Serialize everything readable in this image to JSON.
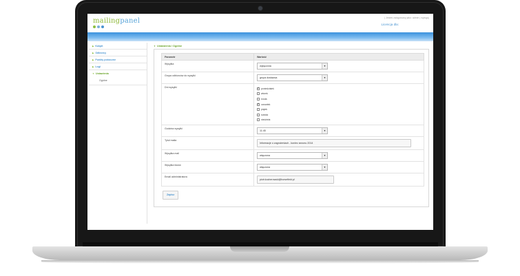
{
  "app": {
    "logo_part1": "mailing",
    "logo_part2": "panel",
    "logo_dot_colors": [
      "#8cbf3f",
      "#7ab0d8",
      "#4a95d1"
    ],
    "top_links": "| Jesteś zalogowany jako: admin | wyloguj",
    "license": "Licencja dla:"
  },
  "sidebar": {
    "items": [
      {
        "label": "Kokpit"
      },
      {
        "label": "Odbiorcy"
      },
      {
        "label": "Punkty poboczne"
      },
      {
        "label": "Logi"
      },
      {
        "label": "Ustawienia"
      }
    ],
    "sub_items": [
      {
        "label": "Ogólne"
      }
    ]
  },
  "main": {
    "breadcrumb": "Ustawienia / Ogólne",
    "table": {
      "col_param": "Parametr",
      "col_value": "Wartość"
    },
    "rows": {
      "wysylka": {
        "label": "Wysyłka",
        "value": "wyłączona"
      },
      "grupa": {
        "label": "Grupa odbiorców do wysyłki",
        "value": "grupa dostawca"
      },
      "dni": {
        "label": "Dni wysyłki"
      },
      "godzina": {
        "label": "Godzina wysyłki",
        "value": "11:45"
      },
      "tytul": {
        "label": "Tytuł maila",
        "value": "Informacje o zagrożeniach - koniec sezonu 2014"
      },
      "mail": {
        "label": "Wysyłka mail",
        "value": "włączona"
      },
      "faks": {
        "label": "Wysyłka faxów",
        "value": "włączona"
      },
      "email": {
        "label": "Email administratora",
        "value": "piotr.kocherowski@horsefield.pl"
      }
    },
    "days": [
      {
        "label": "poniedziałek",
        "checked": true
      },
      {
        "label": "wtorek",
        "checked": false
      },
      {
        "label": "środa",
        "checked": false
      },
      {
        "label": "czwartek",
        "checked": true
      },
      {
        "label": "piątek",
        "checked": false
      },
      {
        "label": "sobota",
        "checked": false
      },
      {
        "label": "niedziela",
        "checked": false
      }
    ],
    "save_label": "Zapisz"
  }
}
